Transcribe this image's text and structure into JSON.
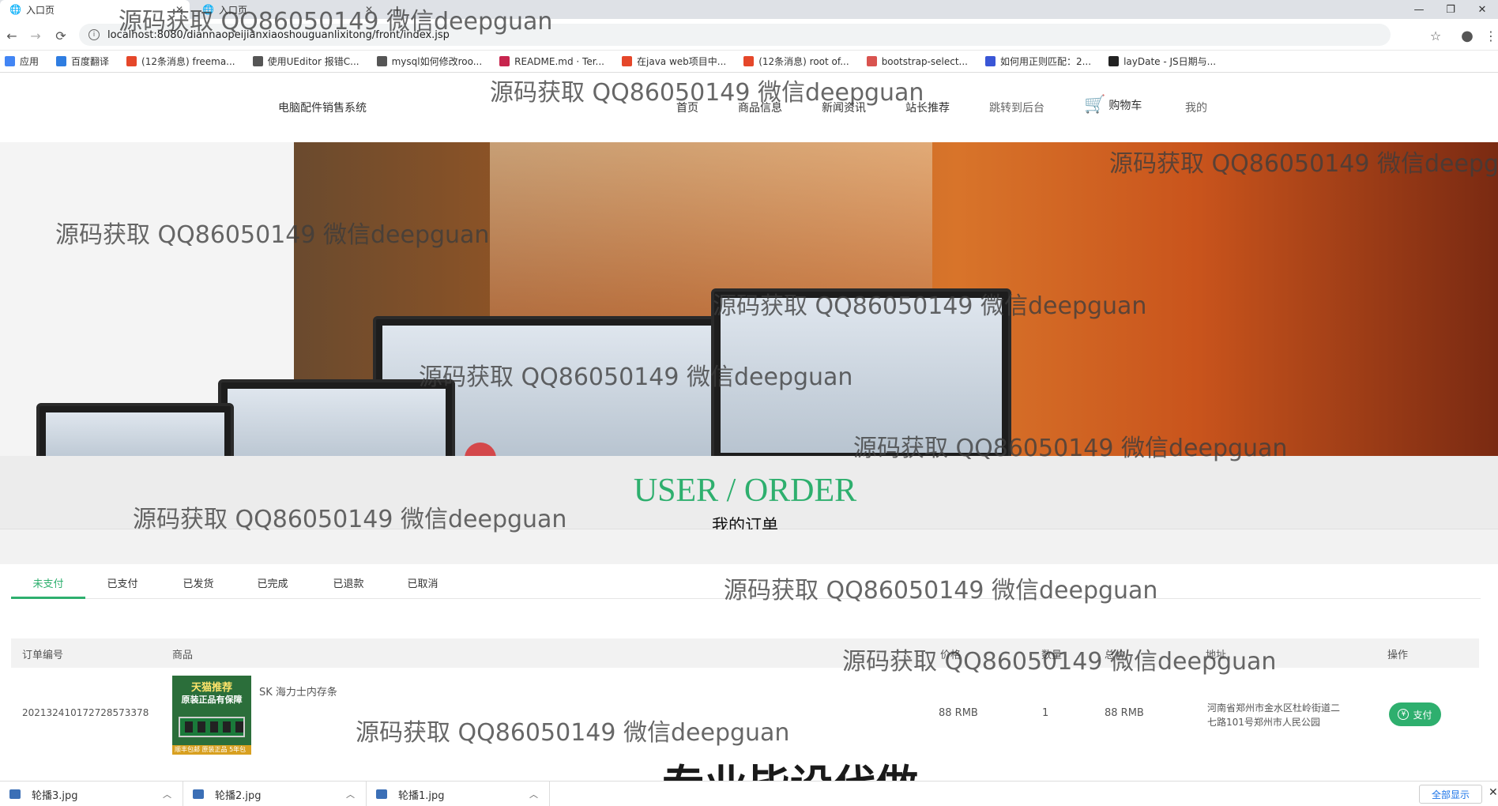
{
  "browser": {
    "tabs": [
      {
        "title": "入口页",
        "active": true
      },
      {
        "title": "入口页",
        "active": false
      }
    ],
    "new_tab": "+",
    "url": "localhost:8080/diannaopeijianxiaoshouguanlixitong/front/index.jsp",
    "bookmarks": [
      {
        "label": "应用",
        "color": "#4285f4"
      },
      {
        "label": "百度翻译",
        "color": "#2f7de1"
      },
      {
        "label": "(12条消息) freema...",
        "color": "#e5472a"
      },
      {
        "label": "使用UEditor 报错C...",
        "color": "#555555"
      },
      {
        "label": "mysql如何修改roo...",
        "color": "#555555"
      },
      {
        "label": "README.md · Ter...",
        "color": "#c7254e"
      },
      {
        "label": "在java web项目中...",
        "color": "#e5472a"
      },
      {
        "label": "(12条消息) root of...",
        "color": "#e5472a"
      },
      {
        "label": "bootstrap-select...",
        "color": "#d9534f"
      },
      {
        "label": "如何用正则匹配：2...",
        "color": "#3a56d6"
      },
      {
        "label": "layDate - JS日期与...",
        "color": "#222222"
      }
    ]
  },
  "site": {
    "logo": "电脑配件销售系统",
    "nav": [
      "首页",
      "商品信息",
      "新闻资讯",
      "站长推荐",
      "跳转到后台"
    ],
    "cart": "购物车",
    "mine": "我的"
  },
  "section": {
    "title": "USER / ORDER",
    "subtitle": "我的订单"
  },
  "order_tabs": [
    "未支付",
    "已支付",
    "已发货",
    "已完成",
    "已退款",
    "已取消"
  ],
  "active_tab": "未支付",
  "table": {
    "headers": [
      "订单编号",
      "商品",
      "价格",
      "数量",
      "总价",
      "地址",
      "操作"
    ],
    "rows": [
      {
        "order_no": "20213241017272857337​8",
        "product": "SK 海力士内存条",
        "price": "88 RMB",
        "qty": "1",
        "total": "88 RMB",
        "address_line1": "河南省郑州市金水区杜岭街道二",
        "address_line2": "七路101号郑州市人民公园",
        "action": "支付",
        "thumb_line1": "天猫推荐",
        "thumb_line2": "原装正品有保障",
        "thumb_footer": "顺丰包邮 原装正品 5年包换"
      }
    ]
  },
  "watermark": "源码获取 QQ86050149 微信deepguan",
  "promo": "专业毕设代做",
  "downloads": {
    "items": [
      "轮播3.jpg",
      "轮播2.jpg",
      "轮播1.jpg"
    ],
    "show_all": "全部显示"
  },
  "colors": {
    "accent": "#2eaf6e"
  }
}
